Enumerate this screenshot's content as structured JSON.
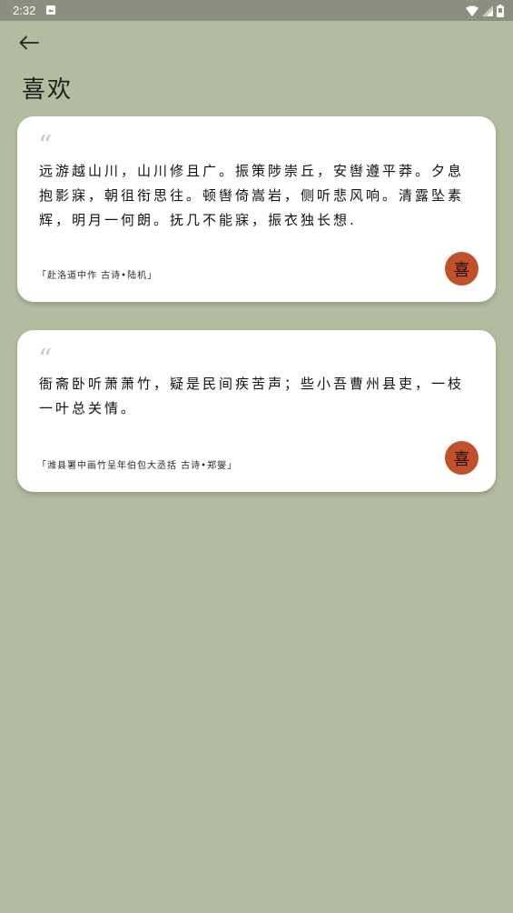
{
  "status_bar": {
    "time": "2:32"
  },
  "header": {
    "back_icon": "arrow-left-icon",
    "title": "喜欢"
  },
  "cards": [
    {
      "quote_mark": "“",
      "text": "远游越山川，山川修且广。振策陟崇丘，安辔遵平莽。夕息抱影寐，朝徂衔思往。顿辔倚嵩岩，侧听悲风响。清露坠素辉，明月一何朗。抚几不能寐，振衣独长想.",
      "source": "「赴洛道中作 古诗•陆机」",
      "badge": "喜"
    },
    {
      "quote_mark": "“",
      "text": "衙斋卧听萧萧竹，疑是民间疾苦声；些小吾曹州县吏，一枝一叶总关情。",
      "source": "「潍县署中画竹呈年伯包大丞括 古诗•郑燮」",
      "badge": "喜"
    }
  ],
  "colors": {
    "background": "#b2bd9f",
    "status_bar": "#8a8f80",
    "card": "#ffffff",
    "badge": "#c2502a"
  }
}
